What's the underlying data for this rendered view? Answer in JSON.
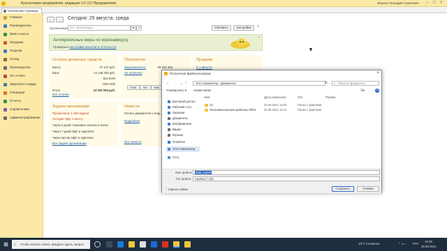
{
  "window": {
    "title": "Бухгалтерия предприятия, редакция 3.0  (1С:Предприятие)",
    "user": "Иванов Геннадий Сергеевич"
  },
  "tabs": [
    {
      "label": "Начальная страница"
    }
  ],
  "sidebar": {
    "items": [
      {
        "label": "Главное",
        "icon": "home-icon",
        "color": "#c8a23a"
      },
      {
        "label": "Руководителю",
        "icon": "chart-icon",
        "color": "#3b7bc8"
      },
      {
        "label": "Банк и касса",
        "icon": "bank-icon",
        "color": "#3a8e5a"
      },
      {
        "label": "Продажи",
        "icon": "sales-icon",
        "color": "#c95c2e"
      },
      {
        "label": "Покупки",
        "icon": "cart-icon",
        "color": "#3b7bc8"
      },
      {
        "label": "Склад",
        "icon": "warehouse-icon",
        "color": "#8a6a3a"
      },
      {
        "label": "Производство",
        "icon": "factory-icon",
        "color": "#6a6a6a"
      },
      {
        "label": "ОС и НМА",
        "icon": "assets-icon",
        "color": "#b04a4a"
      },
      {
        "label": "Зарплата и кадры",
        "icon": "people-icon",
        "color": "#4a7ab0"
      },
      {
        "label": "Операции",
        "icon": "operations-icon",
        "color": "#d07a1a"
      },
      {
        "label": "Отчеты",
        "icon": "reports-icon",
        "color": "#3a8e5a"
      },
      {
        "label": "Справочники",
        "icon": "book-icon",
        "color": "#8a5ab0"
      },
      {
        "label": "Администрирование",
        "icon": "gear-icon",
        "color": "#6a6a6a"
      }
    ]
  },
  "page": {
    "title": "Сегодня: 25 августа, среда",
    "org_label": "Организация:",
    "org_placeholder": "Все организации",
    "refresh_label": "Обновить",
    "settings_label": "Настройка"
  },
  "banner": {
    "title": "Антикризисные меры по коронавирусу",
    "text": "Проверьте ",
    "link": "настройки налогов и отчетности"
  },
  "cash": {
    "title": "Остатки денежных средств",
    "rows": [
      {
        "label": "Касса",
        "value": "47 137 руб."
      },
      {
        "label": "Банк",
        "value": "14 148 325 руб."
      },
      {
        "label": "",
        "value": "524 EUR"
      },
      {
        "label": "",
        "value": "-206 USD"
      },
      {
        "label": "Итого",
        "value": "14 232 054 руб."
      }
    ],
    "link": "Все остатки"
  },
  "tasks": {
    "title": "Задачи организации",
    "rows": [
      {
        "label": "Просрочено: 1 084 задачи",
        "style": "red"
      },
      {
        "label": "Сегодня НДС к зачету",
        "style": "red"
      },
      {
        "label": "Через 5 дней страховые взносы в налог.",
        "style": ""
      },
      {
        "label": "Через 7 дней НДС и зарплата",
        "style": ""
      },
      {
        "label": "Через месяц НДС и зарплата",
        "style": ""
      }
    ],
    "link": "Все задачи организации"
  },
  "buyers": {
    "title": "Покупатели",
    "debt_label": "Задолженность",
    "debt_value": "29 234 205",
    "overdue_label": "Не оплачено",
    "buttons": [
      "Счет",
      "Акт",
      "Нак"
    ]
  },
  "news": {
    "title": "Новости",
    "rows": [
      "Печать документов с Кодом",
      "Подробнее"
    ],
    "link": "Все новости"
  },
  "sales": {
    "title": "Продажи",
    "link": "С 1 августа"
  },
  "dialog": {
    "title": "Получение файла выгрузки",
    "path": [
      "Этот компьютер",
      "Документы"
    ],
    "search_placeholder": "Поиск в: Документы",
    "organize": "Упорядочить ▾",
    "new_folder": "Новая папка",
    "tree": [
      {
        "label": "Быстрый доступ",
        "color": "#3b7bc8"
      },
      {
        "label": "Рабочий стол",
        "color": "#3b7bc8"
      },
      {
        "label": "Загрузки",
        "color": "#3b7bc8"
      },
      {
        "label": "Документы",
        "color": "#6a6a6a"
      },
      {
        "label": "Изображения",
        "color": "#3b7bc8"
      },
      {
        "label": "Видео",
        "color": "#6a6a6a"
      },
      {
        "label": "Музыка",
        "color": "#6a6a6a"
      },
      {
        "label": "OneDrive",
        "color": "#1a7ad4"
      },
      {
        "label": "Этот компьютер",
        "color": "#4a8ad4"
      },
      {
        "label": "Сеть",
        "color": "#4a8ad4"
      }
    ],
    "columns": [
      "Имя",
      "Дата изменения",
      "Тип",
      "Размер"
    ],
    "files": [
      {
        "name": "1С",
        "date": "25.08.2021 16:04",
        "type": "Папка с файлами",
        "size": ""
      },
      {
        "name": "Пользовательские шаблоны Office",
        "date": "25.08.2021 16:12",
        "type": "Папка с файлами",
        "size": ""
      }
    ],
    "filename_label": "Имя файла:",
    "filename_value": "data_export",
    "filetype_label": "Тип файла:",
    "filetype_value": "Архивы (*.zip)",
    "hide_folders": "Скрыть папки",
    "save_label": "Сохранить",
    "cancel_label": "Отмена"
  },
  "taskbar": {
    "search_placeholder": "Чтобы начать поиск, введите здесь запрос",
    "weather": "18°C  Солнечно",
    "lang": "РУС",
    "time": "16:28",
    "date": "25.08.2021"
  }
}
